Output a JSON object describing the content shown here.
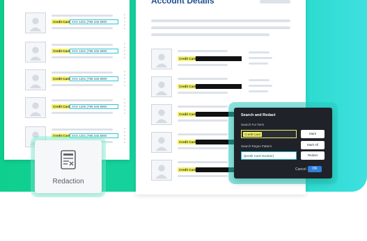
{
  "colors": {
    "accent_green": "#17d3a0",
    "highlight_yellow": "#f3f36a",
    "highlight_cyan": "#2ec4d4",
    "dialog_bg": "#1f2329",
    "title_blue": "#1d4e8f"
  },
  "left_document": {
    "rows": [
      {
        "label": "Credit Card",
        "number": "XXX 1201 (798 345 8900"
      },
      {
        "label": "Credit Card",
        "number": "XXX 1201 (798 345 8900"
      },
      {
        "label": "Credit Card",
        "number": "XXX 1201 (798 345 8900"
      },
      {
        "label": "Credit Card",
        "number": "XXX 1200 (798 345 8900"
      },
      {
        "label": "Credit Card",
        "number": "XXX 1201 (798 345 8900"
      }
    ]
  },
  "right_document": {
    "title": "Account Details",
    "rows": [
      {
        "label": "Credit Card"
      },
      {
        "label": "Credit Card"
      },
      {
        "label": "Credit Card"
      },
      {
        "label": "Credit Card"
      },
      {
        "label": "Credit Card"
      }
    ]
  },
  "redaction_card": {
    "icon": "redaction-doc-icon",
    "label": "Redaction"
  },
  "dialog": {
    "title": "Search and Redact",
    "search_term_label": "Search For Term",
    "search_term_value": "Credit Card",
    "regex_label": "Search Regex Pattern",
    "regex_value": "(Credit Card Number)",
    "mark_label": "Mark",
    "mark_all_label": "Mark All",
    "redact_label": "Redact",
    "cancel_label": "Cancel",
    "ok_label": "OK"
  }
}
